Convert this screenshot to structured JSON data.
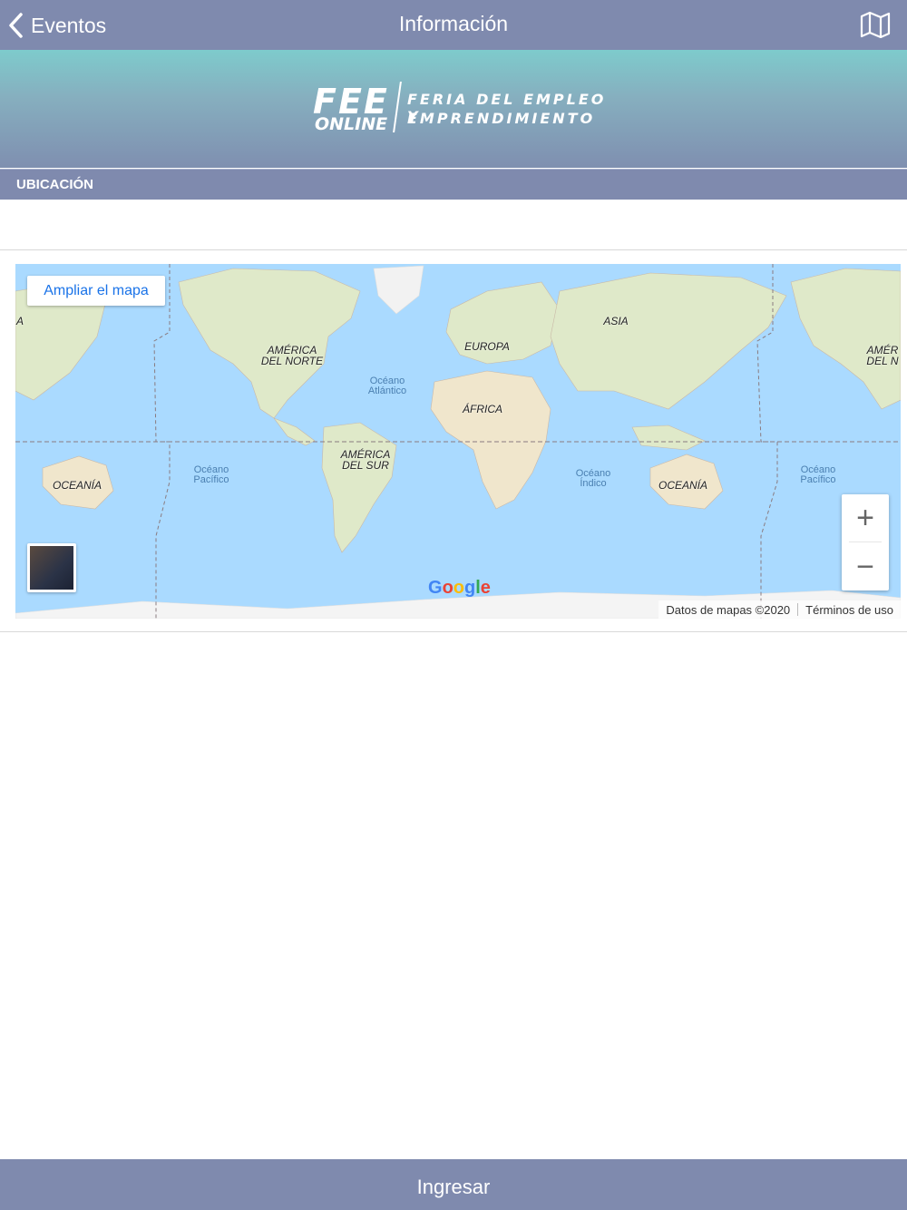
{
  "nav": {
    "back_label": "Eventos",
    "title": "Información"
  },
  "banner": {
    "logo_main": "FEE",
    "logo_sub": "ONLINE",
    "logo_line1": "FERIA DEL EMPLEO Y",
    "logo_line2": "EMPRENDIMIENTO"
  },
  "section": {
    "label": "UBICACIÓN"
  },
  "map": {
    "expand_label": "Ampliar el mapa",
    "continents": [
      "AMÉRICA DEL NORTE",
      "EUROPA",
      "ASIA",
      "ÁFRICA",
      "AMÉRICA DEL SUR",
      "OCEANÍA",
      "OCEANÍA",
      "AMÉR DEL N",
      "A"
    ],
    "oceans": [
      "Océano Atlántico",
      "Océano Pacífico",
      "Océano Índico",
      "Océano Pacífico"
    ],
    "zoom_in": "+",
    "zoom_out": "−",
    "google": "Google",
    "attribution_data": "Datos de mapas ©2020",
    "attribution_terms": "Términos de uso"
  },
  "bottom": {
    "button_label": "Ingresar"
  },
  "colors": {
    "bar": "#7f8aae",
    "ocean": "#aadaff",
    "land": "#dfe9c9"
  }
}
